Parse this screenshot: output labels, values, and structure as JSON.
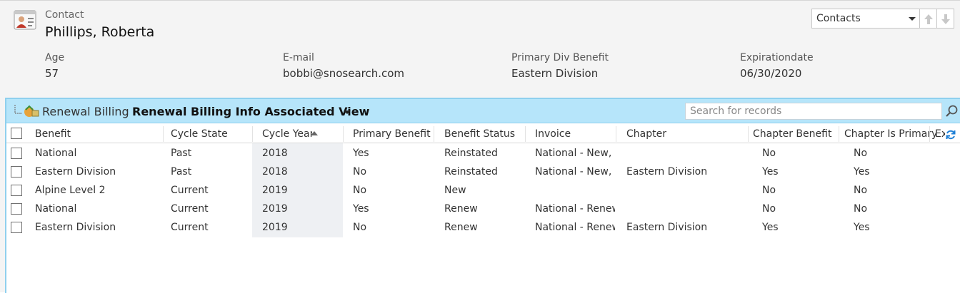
{
  "header": {
    "entity_label": "Contact",
    "record_name": "Phillips, Roberta",
    "entity_icon": "contact-card-icon"
  },
  "navigator": {
    "selected": "Contacts",
    "up_icon": "arrow-up-icon",
    "down_icon": "arrow-down-icon"
  },
  "fields": [
    {
      "label": "Age",
      "value": "57"
    },
    {
      "label": "E-mail",
      "value": "bobbi@snosearch.com"
    },
    {
      "label": "Primary Div Benefit",
      "value": "Eastern Division"
    },
    {
      "label": "Expirationdate",
      "value": "06/30/2020"
    }
  ],
  "subgrid": {
    "title": "Renewal Billing",
    "view_name": "Renewal Billing Info Associated View",
    "search_placeholder": "Search for records",
    "columns": [
      "Benefit",
      "Cycle State",
      "Cycle Year",
      "Primary Benefit",
      "Benefit Status",
      "Invoice",
      "Chapter",
      "Chapter Benefit",
      "Chapter Is Primary",
      "Ex"
    ],
    "sorted_column": "Cycle Year",
    "sort_direction": "ascending",
    "rows": [
      [
        "National",
        "Past",
        "2018",
        "Yes",
        "Reinstated",
        "National - New, E",
        "",
        "No",
        "No"
      ],
      [
        "Eastern Division",
        "Past",
        "2018",
        "No",
        "Reinstated",
        "National - New, E",
        "Eastern Division",
        "Yes",
        "Yes"
      ],
      [
        "Alpine Level 2",
        "Current",
        "2019",
        "No",
        "New",
        "",
        "",
        "No",
        "No"
      ],
      [
        "National",
        "Current",
        "2019",
        "Yes",
        "Renew",
        "National - Renew",
        "",
        "No",
        "No"
      ],
      [
        "Eastern Division",
        "Current",
        "2019",
        "No",
        "Renew",
        "National - Renew",
        "Eastern Division",
        "Yes",
        "Yes"
      ]
    ]
  },
  "colors": {
    "grid_bar": "#b6e5fa",
    "grid_border": "#8fd0ee",
    "refresh_icon": "#1e7fd6"
  }
}
